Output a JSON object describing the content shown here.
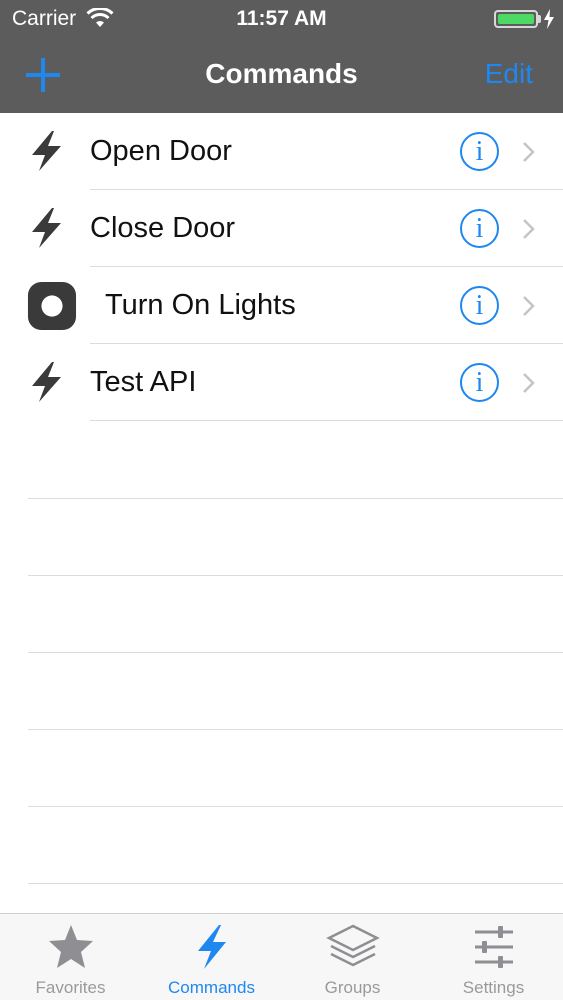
{
  "status_bar": {
    "carrier": "Carrier",
    "time": "11:57 AM",
    "icons": [
      "wifi-icon",
      "battery-icon",
      "charging-bolt-icon"
    ]
  },
  "nav_bar": {
    "title": "Commands",
    "left_button_icon": "plus-icon",
    "right_button_label": "Edit"
  },
  "commands": [
    {
      "label": "Open Door",
      "icon": "bolt-icon",
      "accessory": "info-icon"
    },
    {
      "label": "Close Door",
      "icon": "bolt-icon",
      "accessory": "info-icon"
    },
    {
      "label": "Turn On Lights",
      "icon": "record-button-icon",
      "accessory": "info-icon"
    },
    {
      "label": "Test API",
      "icon": "bolt-icon",
      "accessory": "info-icon"
    }
  ],
  "tab_bar": {
    "tabs": [
      {
        "label": "Favorites",
        "icon": "star-icon",
        "active": false
      },
      {
        "label": "Commands",
        "icon": "bolt-icon",
        "active": true
      },
      {
        "label": "Groups",
        "icon": "stack-icon",
        "active": false
      },
      {
        "label": "Settings",
        "icon": "sliders-icon",
        "active": false
      }
    ]
  },
  "colors": {
    "nav_background": "#5c5c5c",
    "accent": "#1e88f0",
    "battery": "#4cd964",
    "tab_inactive": "#9a9a9a"
  }
}
